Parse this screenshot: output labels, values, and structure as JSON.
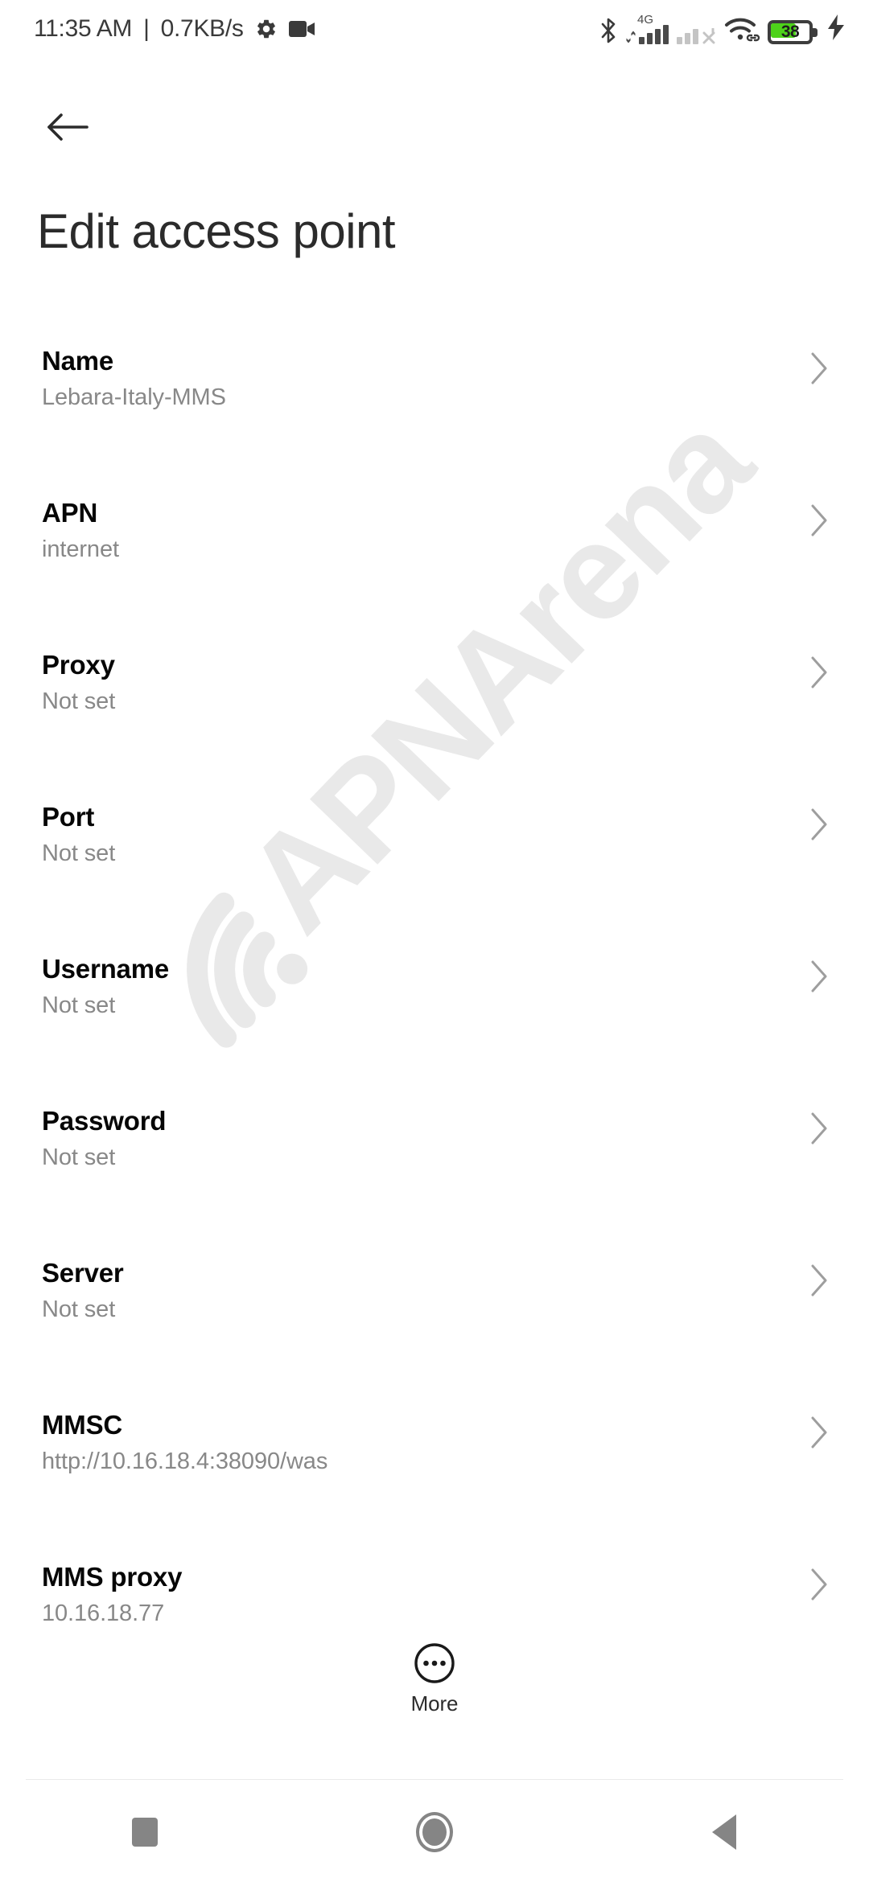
{
  "status_bar": {
    "time": "11:35 AM",
    "separator": "|",
    "network_speed": "0.7KB/s",
    "network_label": "4G",
    "battery_level": "38",
    "icons": {
      "gear": "gear-icon",
      "camera": "video-camera-icon",
      "bluetooth": "bluetooth-icon",
      "signal_sim1": "signal-bars-4g-icon",
      "signal_sim2": "signal-no-service-icon",
      "wifi": "wifi-icon",
      "battery": "battery-icon",
      "charging": "charging-bolt-icon"
    },
    "colors": {
      "text": "#3a3a3a",
      "icon": "#4a4a4a",
      "icon_dim": "#c4c4c4",
      "battery_fill": "#4dd21a",
      "battery_outline": "#3d3d3d"
    }
  },
  "app_bar": {
    "back_label": "Back",
    "title": "Edit access point"
  },
  "watermark": {
    "text": "APNArena",
    "color": "#e9e9e9"
  },
  "settings_list": [
    {
      "title": "Name",
      "value": "Lebara-Italy-MMS"
    },
    {
      "title": "APN",
      "value": "internet"
    },
    {
      "title": "Proxy",
      "value": "Not set"
    },
    {
      "title": "Port",
      "value": "Not set"
    },
    {
      "title": "Username",
      "value": "Not set"
    },
    {
      "title": "Password",
      "value": "Not set"
    },
    {
      "title": "Server",
      "value": "Not set"
    },
    {
      "title": "MMSC",
      "value": "http://10.16.18.4:38090/was"
    },
    {
      "title": "MMS proxy",
      "value": "10.16.18.77"
    }
  ],
  "more_button": {
    "label": "More"
  },
  "nav_bar": {
    "recents_label": "Recents",
    "home_label": "Home",
    "back_label": "Back"
  }
}
